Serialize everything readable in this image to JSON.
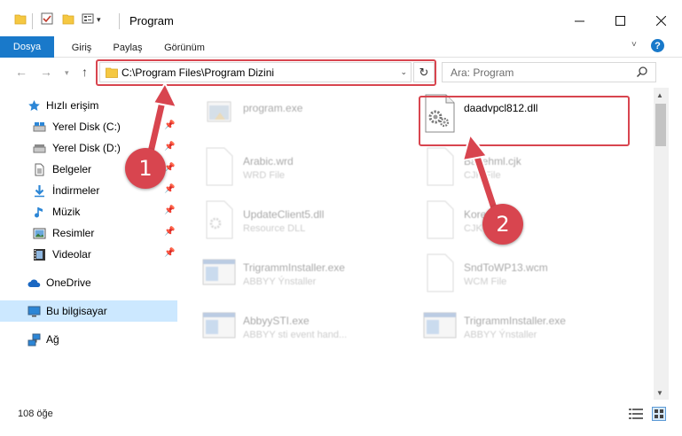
{
  "window": {
    "title": "Program"
  },
  "ribbon": {
    "tabs": [
      "Dosya",
      "Giriş",
      "Paylaş",
      "Görünüm"
    ],
    "help_label": "?"
  },
  "navigation": {
    "address": "C:\\Program Files\\Program Dizini",
    "search_placeholder": "Ara: Program"
  },
  "sidebar": {
    "quick_access": "Hızlı erişim",
    "items": [
      {
        "label": "Yerel Disk (C:)",
        "icon": "drive-icon"
      },
      {
        "label": "Yerel Disk (D:)",
        "icon": "drive-icon"
      },
      {
        "label": "Belgeler",
        "icon": "documents-icon"
      },
      {
        "label": "İndirmeler",
        "icon": "download-icon"
      },
      {
        "label": "Müzik",
        "icon": "music-icon"
      },
      {
        "label": "Resimler",
        "icon": "pictures-icon"
      },
      {
        "label": "Videolar",
        "icon": "videos-icon"
      }
    ],
    "onedrive": "OneDrive",
    "this_pc": "Bu bilgisayar",
    "network": "Ağ"
  },
  "files": [
    {
      "name": "program.exe",
      "desc": "",
      "icon": "exe-icon",
      "faded": true
    },
    {
      "name": "daadvpcl812.dll",
      "desc": "",
      "icon": "dll-gear-icon",
      "faded": false
    },
    {
      "name": "Arabic.wrd",
      "desc": "WRD File",
      "icon": "file-icon",
      "faded": true
    },
    {
      "name": "Basehml.cjk",
      "desc": "CJK File",
      "icon": "file-icon",
      "faded": true
    },
    {
      "name": "UpdateClient5.dll",
      "desc": "Resource DLL",
      "icon": "dll-gear-icon",
      "faded": true
    },
    {
      "name": "Korean.cjk",
      "desc": "CJK File",
      "icon": "file-icon",
      "faded": true
    },
    {
      "name": "TrigrammInstaller.exe",
      "desc": "ABBYY Ýnstaller",
      "icon": "exe-icon",
      "faded": true
    },
    {
      "name": "SndToWP13.wcm",
      "desc": "WCM File",
      "icon": "file-icon",
      "faded": true
    },
    {
      "name": "AbbyySTI.exe",
      "desc": "ABBYY sti event hand...",
      "icon": "exe-icon",
      "faded": true
    },
    {
      "name": "TrigrammInstaller.exe",
      "desc": "ABBYY Ýnstaller",
      "icon": "exe-icon",
      "faded": true
    }
  ],
  "status": {
    "item_count": "108 öğe"
  },
  "annotations": {
    "step1": "1",
    "step2": "2"
  },
  "colors": {
    "accent": "#1979ca",
    "highlight": "#d8454f",
    "selected": "#cce8ff"
  }
}
